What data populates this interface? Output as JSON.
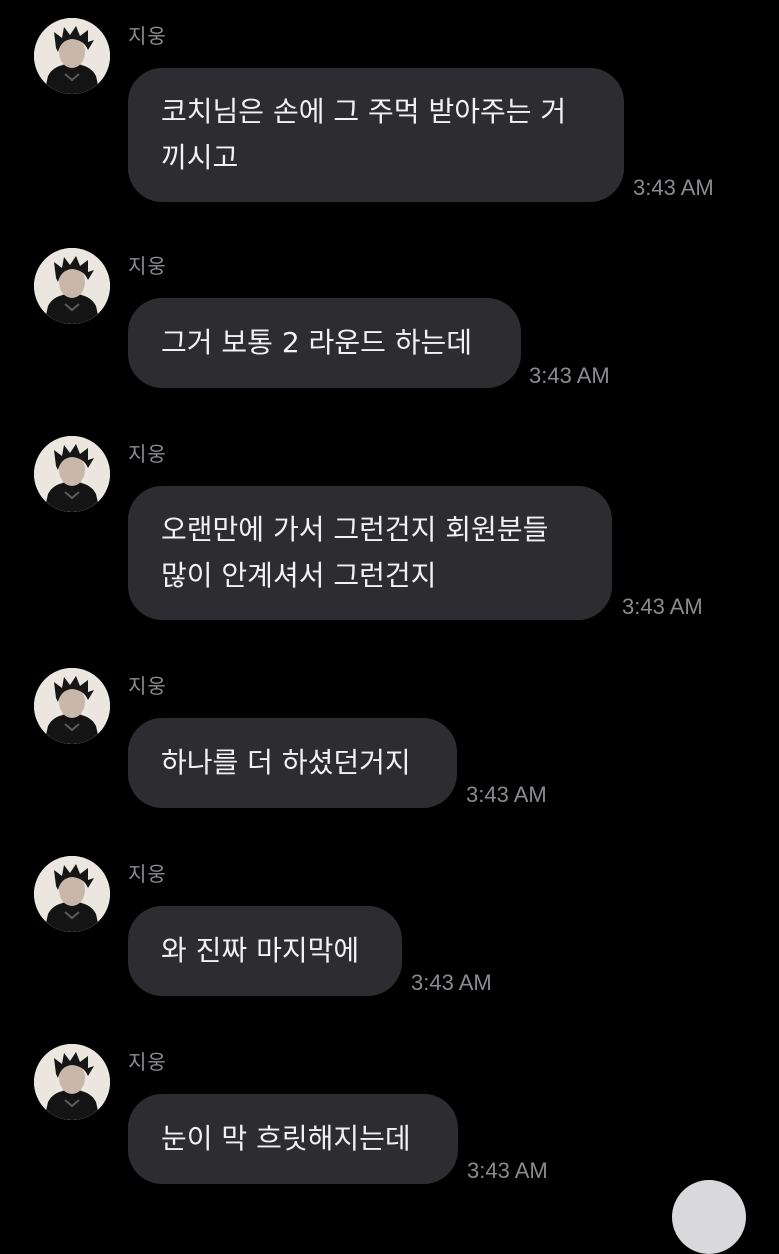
{
  "messages": [
    {
      "sender": "지웅",
      "text": "코치님은 손에 그 주먹 받아주는 거\n끼시고",
      "time": "3:43 AM"
    },
    {
      "sender": "지웅",
      "text": "그거 보통 2 라운드 하는데",
      "time": "3:43 AM"
    },
    {
      "sender": "지웅",
      "text": "오랜만에 가서 그런건지 회원분들\n많이 안계셔서 그런건지",
      "time": "3:43 AM"
    },
    {
      "sender": "지웅",
      "text": "하나를 더 하셨던거지",
      "time": "3:43 AM"
    },
    {
      "sender": "지웅",
      "text": "와 진짜 마지막에",
      "time": "3:43 AM"
    },
    {
      "sender": "지웅",
      "text": "눈이 막 흐릿해지는데",
      "time": "3:43 AM"
    }
  ],
  "colors": {
    "background": "#000000",
    "bubble": "#2d2d31",
    "message_text": "#f2f2f4",
    "meta_text": "#8a8a8f"
  }
}
